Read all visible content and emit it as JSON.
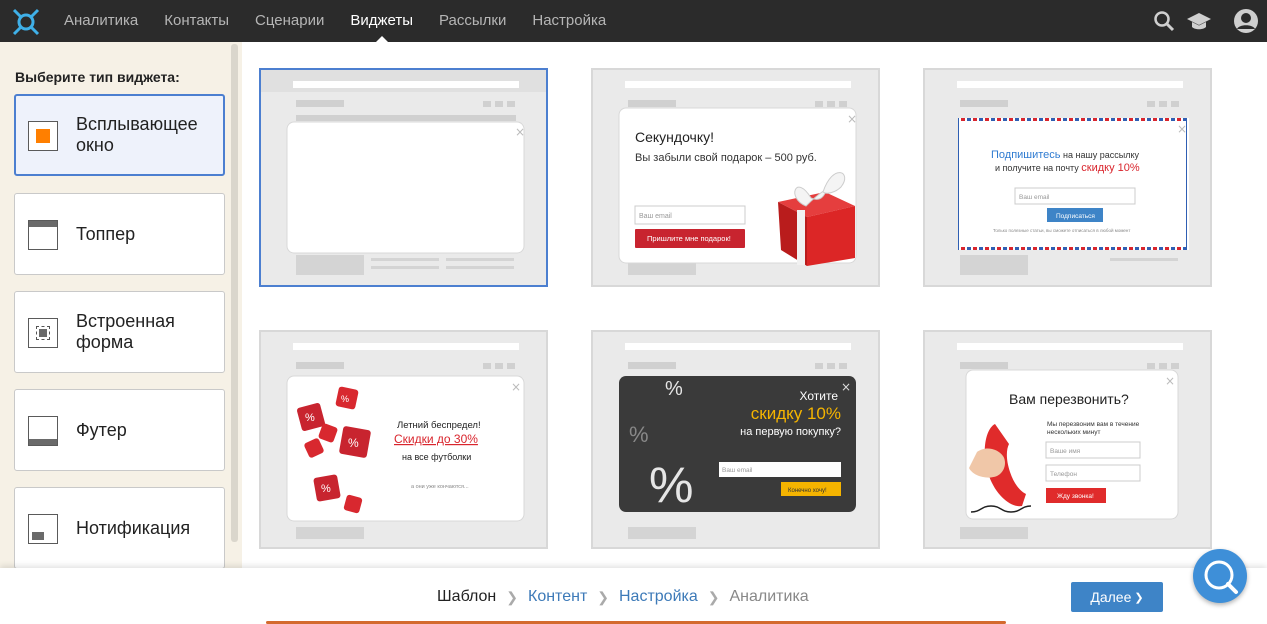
{
  "nav": {
    "items": [
      {
        "label": "Аналитика",
        "active": false
      },
      {
        "label": "Контакты",
        "active": false
      },
      {
        "label": "Сценарии",
        "active": false
      },
      {
        "label": "Виджеты",
        "active": true
      },
      {
        "label": "Рассылки",
        "active": false
      },
      {
        "label": "Настройка",
        "active": false
      }
    ],
    "icons": [
      "search-icon",
      "graduation-cap-icon",
      "user-avatar-icon"
    ]
  },
  "sidebar": {
    "heading": "Выберите тип виджета:",
    "types": [
      {
        "label": "Всплывающее окно",
        "icon": "popup-icon",
        "active": true
      },
      {
        "label": "Топпер",
        "icon": "topper-icon",
        "active": false
      },
      {
        "label": "Встроенная форма",
        "icon": "embedded-form-icon",
        "active": false
      },
      {
        "label": "Футер",
        "icon": "footer-icon",
        "active": false
      },
      {
        "label": "Нотификация",
        "icon": "notification-icon",
        "active": false
      }
    ]
  },
  "templates": [
    {
      "kind": "blank",
      "selected": true
    },
    {
      "kind": "gift",
      "title": "Секундочку!",
      "subtitle": "Вы забыли свой подарок – 500 руб.",
      "placeholder": "Ваш email",
      "button": "Пришлите мне подарок!"
    },
    {
      "kind": "newsletter",
      "line1_accent": "Подпишитесь",
      "line1_rest": " на нашу рассылку",
      "line2_start": "и получите на почту ",
      "line2_accent": "скидку 10%",
      "placeholder": "Ваш email",
      "button": "Подписаться",
      "note": "Только полезные статьи, вы сможете отписаться в любой момент"
    },
    {
      "kind": "dice",
      "line1": "Летний беспредел!",
      "line2": "Скидки до 30%",
      "line3": "на все футболки",
      "note": "а они уже кончаются..."
    },
    {
      "kind": "dark",
      "line1": "Хотите",
      "line2": "скидку 10%",
      "line3": "на первую покупку?",
      "placeholder": "Ваш email",
      "button": "Конечно хочу!"
    },
    {
      "kind": "callback",
      "title": "Вам перезвонить?",
      "subtitle1": "Мы перезвоним вам в течение",
      "subtitle2": "нескольких минут",
      "placeholder_name": "Ваше имя",
      "placeholder_phone": "Телефон",
      "button": "Жду звонка!"
    }
  ],
  "steps": [
    {
      "label": "Шаблон",
      "state": "current"
    },
    {
      "label": "Контент",
      "state": "link"
    },
    {
      "label": "Настройка",
      "state": "link"
    },
    {
      "label": "Аналитика",
      "state": "disabled"
    }
  ],
  "next_button": "Далее",
  "colors": {
    "accent": "#4c7fd0",
    "orange": "#ff7f00",
    "red": "#c8242f",
    "nav_bg": "#2b2b2b"
  }
}
